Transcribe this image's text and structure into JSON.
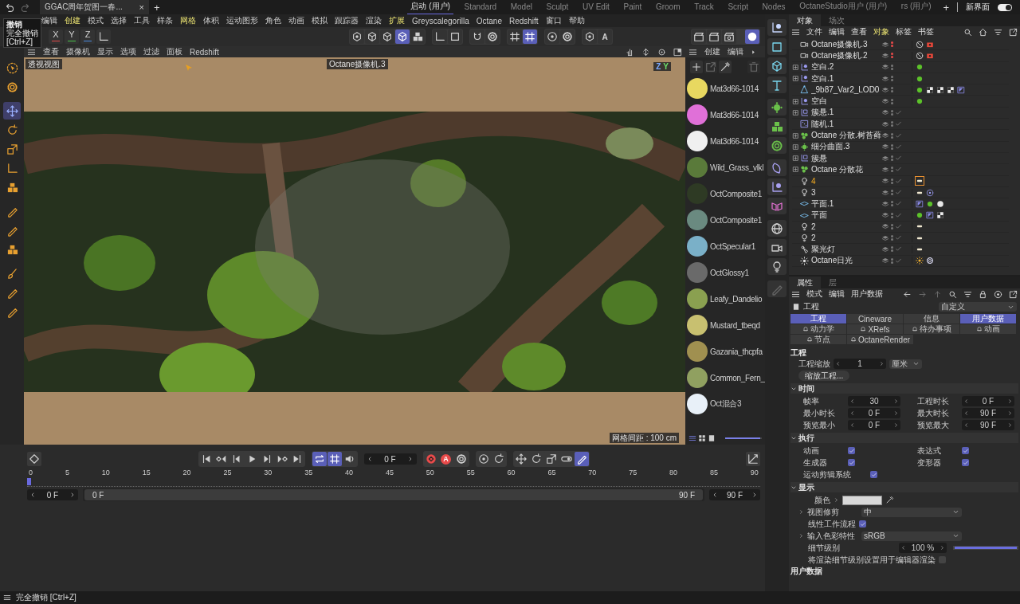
{
  "title_bar": {
    "document_tab": "GGAC周年贺图一春...",
    "close": "×",
    "add": "+",
    "layouts": [
      {
        "label": "启动 (用户)",
        "selected": true
      },
      {
        "label": "Standard",
        "selected": false
      },
      {
        "label": "Model",
        "selected": false
      },
      {
        "label": "Sculpt",
        "selected": false
      },
      {
        "label": "UV Edit",
        "selected": false
      },
      {
        "label": "Paint",
        "selected": false
      },
      {
        "label": "Groom",
        "selected": false
      },
      {
        "label": "Track",
        "selected": false
      },
      {
        "label": "Script",
        "selected": false
      },
      {
        "label": "Nodes",
        "selected": false
      },
      {
        "label": "OctaneStudio用户 (用户)",
        "selected": false
      },
      {
        "label": "rs (用户)",
        "selected": false
      }
    ],
    "add_layout": "+",
    "new_layout": "新界面",
    "toggle_on": true
  },
  "menu_bar": [
    "编辑",
    "创建",
    "模式",
    "选择",
    "工具",
    "样条",
    "网格",
    "体积",
    "运动图形",
    "角色",
    "动画",
    "模拟",
    "跟踪器",
    "渲染",
    "扩展",
    "Greyscalegorilla",
    "Octane",
    "Redshift",
    "窗口",
    "帮助"
  ],
  "tooltip": {
    "title": "撤销",
    "text": "完全撤销",
    "shortcut": "[Ctrl+Z]"
  },
  "toolbar": {
    "axes": [
      {
        "label": "X",
        "color": "#e04848"
      },
      {
        "label": "Y",
        "color": "#48c048"
      },
      {
        "label": "Z",
        "color": "#4888e0"
      }
    ],
    "center": [
      [
        {
          "selected": false
        },
        {
          "selected": false
        },
        {
          "selected": false
        },
        {
          "selected": true
        },
        {
          "selected": false
        }
      ],
      [
        {
          "selected": false
        },
        {
          "selected": false
        }
      ],
      [
        {
          "selected": false
        },
        {
          "selected": false
        }
      ],
      [
        {
          "selected": false
        },
        {
          "selected": true
        }
      ],
      [
        {
          "selected": false
        },
        {
          "selected": false
        }
      ],
      [
        {
          "selected": false
        },
        {
          "label": "A",
          "selected": false
        }
      ]
    ],
    "right": [
      {
        "selected": false
      },
      {
        "selected": false
      },
      {
        "selected": false
      },
      {
        "selected": true
      }
    ]
  },
  "left_tools": [
    {
      "selected": false
    },
    {
      "selected": false
    },
    {
      "selected": true
    },
    {
      "selected": false
    },
    {
      "selected": false
    },
    {
      "selected": false
    },
    {
      "selected": false
    },
    {
      "selected": false
    },
    {
      "selected": false
    },
    {
      "selected": false
    },
    {
      "selected": false
    },
    {
      "selected": false
    },
    {
      "selected": false
    }
  ],
  "viewport": {
    "menu": [
      "查看",
      "摄像机",
      "显示",
      "选项",
      "过滤",
      "面板",
      "Redshift"
    ],
    "view_label": "透视视图",
    "camera_label": "Octane摄像机.3",
    "axis_labels": [
      "Z",
      "Y"
    ],
    "grid_label": "网格间距 : 100 cm"
  },
  "materials": {
    "menu": [
      "创建",
      "编辑"
    ],
    "items": [
      {
        "name": "Mat3d66-1014",
        "color": "#e8d860"
      },
      {
        "name": "Mat3d66-1014",
        "color": "#e070d8"
      },
      {
        "name": "Mat3d66-1014",
        "color": "#f0f0f0"
      },
      {
        "name": "Wild_Grass_vlkl",
        "color": "#5a7a3a"
      },
      {
        "name": "OctComposite1",
        "color": "#2e3a24"
      },
      {
        "name": "OctComposite1",
        "color": "#6a8a80"
      },
      {
        "name": "OctSpecular1",
        "color": "#7ab0c8"
      },
      {
        "name": "OctGlossy1",
        "color": "#6a6a6a"
      },
      {
        "name": "Leafy_Dandelio",
        "color": "#8aa050"
      },
      {
        "name": "Mustard_tbeqd",
        "color": "#c8c070"
      },
      {
        "name": "Gazania_thcpfa",
        "color": "#a09050"
      },
      {
        "name": "Common_Fern_",
        "color": "#90a060"
      },
      {
        "name": "Oct混合3",
        "color": "#e8f0f8"
      }
    ],
    "zoom": {
      "level": 0.95
    }
  },
  "objects": {
    "tabs": [
      {
        "label": "对象",
        "selected": true
      },
      {
        "label": "场次",
        "selected": false
      }
    ],
    "menu": [
      {
        "label": "文件",
        "selected": false
      },
      {
        "label": "编辑",
        "selected": false
      },
      {
        "label": "查看",
        "selected": false
      },
      {
        "label": "对象",
        "selected": true
      },
      {
        "label": "标签",
        "selected": false
      },
      {
        "label": "书签",
        "selected": false
      }
    ],
    "rows": [
      {
        "name": "Octane摄像机.3",
        "expandable": false,
        "hidden": true,
        "checked": false,
        "selected": false
      },
      {
        "name": "Octane摄像机.2",
        "expandable": false,
        "hidden": true,
        "checked": false,
        "selected": false
      },
      {
        "name": "空白.2",
        "expandable": true,
        "hidden": false,
        "checked": false,
        "selected": false
      },
      {
        "name": "空白.1",
        "expandable": true,
        "hidden": false,
        "checked": false,
        "selected": false
      },
      {
        "name": "_9b87_Var2_LOD0",
        "expandable": false,
        "hidden": false,
        "checked": false,
        "selected": false
      },
      {
        "name": "空白",
        "expandable": true,
        "hidden": false,
        "checked": false,
        "selected": false
      },
      {
        "name": "簇悬.1",
        "expandable": true,
        "hidden": false,
        "checked": true,
        "selected": false
      },
      {
        "name": "随机.1",
        "expandable": false,
        "hidden": false,
        "checked": true,
        "selected": false
      },
      {
        "name": "Octane 分散.树苔藓",
        "expandable": true,
        "hidden": false,
        "checked": true,
        "selected": false
      },
      {
        "name": "细分曲面.3",
        "expandable": true,
        "hidden": false,
        "checked": true,
        "selected": false
      },
      {
        "name": "簇悬",
        "expandable": true,
        "hidden": false,
        "checked": true,
        "selected": false
      },
      {
        "name": "Octane 分散花",
        "expandable": true,
        "hidden": false,
        "checked": true,
        "selected": false
      },
      {
        "name": "4",
        "expandable": false,
        "hidden": false,
        "checked": true,
        "selected": true
      },
      {
        "name": "3",
        "expandable": false,
        "hidden": false,
        "checked": true,
        "selected": false
      },
      {
        "name": "平面.1",
        "expandable": false,
        "hidden": false,
        "checked": true,
        "selected": false
      },
      {
        "name": "平面",
        "expandable": false,
        "hidden": false,
        "checked": true,
        "selected": false
      },
      {
        "name": "2",
        "expandable": false,
        "hidden": false,
        "checked": true,
        "selected": false
      },
      {
        "name": "2",
        "expandable": false,
        "hidden": false,
        "checked": true,
        "selected": false
      },
      {
        "name": "聚光灯",
        "expandable": false,
        "hidden": false,
        "checked": true,
        "selected": false
      },
      {
        "name": "Octane日光",
        "expandable": false,
        "hidden": false,
        "checked": true,
        "selected": false
      }
    ]
  },
  "attributes": {
    "tabs": [
      {
        "label": "属性",
        "selected": true
      },
      {
        "label": "层",
        "selected": false
      }
    ],
    "menu": [
      "模式",
      "编辑",
      "用户数据"
    ],
    "header": "工程",
    "preset": "自定义",
    "tab_rows": [
      [
        {
          "label": "工程",
          "selected": true,
          "bell": false
        },
        {
          "label": "Cineware",
          "selected": false,
          "bell": false
        },
        {
          "label": "信息",
          "selected": false,
          "bell": false
        },
        {
          "label": "用户数据",
          "selected": true,
          "bell": false
        }
      ],
      [
        {
          "label": "动力学",
          "selected": false,
          "bell": true
        },
        {
          "label": "XRefs",
          "selected": false,
          "bell": true
        },
        {
          "label": "待办事项",
          "selected": false,
          "bell": true
        },
        {
          "label": "动画",
          "selected": false,
          "bell": true
        }
      ],
      [
        {
          "label": "节点",
          "selected": false,
          "bell": true
        },
        {
          "label": "OctaneRender",
          "selected": false,
          "bell": true
        }
      ]
    ],
    "project_title": "工程",
    "scale_label": "工程缩放",
    "scale_value": "1",
    "scale_unit": "厘米",
    "scale_button": "缩放工程...",
    "sections": [
      {
        "title": "时间",
        "kind": "fields",
        "items": [
          {
            "label": "帧率",
            "value": "30"
          },
          {
            "label": "工程时长",
            "value": "0 F"
          },
          {
            "label": "最小时长",
            "value": "0 F"
          },
          {
            "label": "最大时长",
            "value": "90 F"
          },
          {
            "label": "预览最小",
            "value": "0 F"
          },
          {
            "label": "预览最大",
            "value": "90 F"
          }
        ]
      },
      {
        "title": "执行",
        "kind": "checks",
        "items": [
          {
            "label": "动画",
            "checked": true
          },
          {
            "label": "表达式",
            "checked": true
          },
          {
            "label": "生成器",
            "checked": true
          },
          {
            "label": "变形器",
            "checked": true
          },
          {
            "label": "运动剪辑系统",
            "checked": true
          }
        ]
      },
      {
        "title": "显示",
        "kind": "display",
        "color_label": "颜色",
        "color": "#d8d8d8",
        "clip_label": "视图修剪",
        "clip_value": "中",
        "linear_label": "线性工作流程",
        "linear_checked": true,
        "profile_label": "输入色彩特性",
        "profile_value": "sRGB",
        "lod_label": "细节级别",
        "lod_value": "100 %",
        "lod": {
          "level": 1
        },
        "render_lod_label": "将渲染细节级别设置用于编辑器渲染",
        "render_lod_checked": false
      }
    ],
    "user_data_title": "用户数据"
  },
  "timeline": {
    "frame": "0 F",
    "autokey_label": "A",
    "ticks": [
      "0",
      "5",
      "10",
      "15",
      "20",
      "25",
      "30",
      "35",
      "40",
      "45",
      "50",
      "55",
      "60",
      "65",
      "70",
      "75",
      "80",
      "85",
      "90"
    ],
    "playhead": {
      "level": 0
    },
    "range_start": "0 F",
    "range": {
      "level": 1
    },
    "range_bar_start": "0 F",
    "range_bar_end": "90 F",
    "range_end": "90 F"
  },
  "status_bar": "完全撤销 [Ctrl+Z]"
}
